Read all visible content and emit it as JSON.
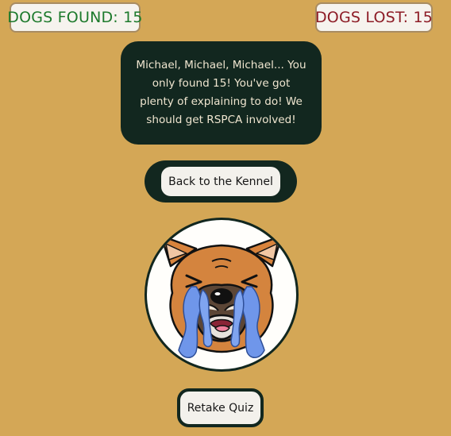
{
  "scoreboard": {
    "found_label": "DOGS FOUND: 15",
    "lost_label": "DOGS LOST: 15",
    "found_color": "#1d7a2c",
    "lost_color": "#8d1c26"
  },
  "result": {
    "message": "Michael, Michael, Michael... You only found 15! You've got plenty of explaining to do! We should get RSPCA involved!"
  },
  "buttons": {
    "back_label": "Back to the Kennel",
    "retake_label": "Retake Quiz"
  },
  "theme": {
    "background": "#d4a756",
    "dark_panel": "#12271f",
    "tear_color": "#6f96ea"
  }
}
